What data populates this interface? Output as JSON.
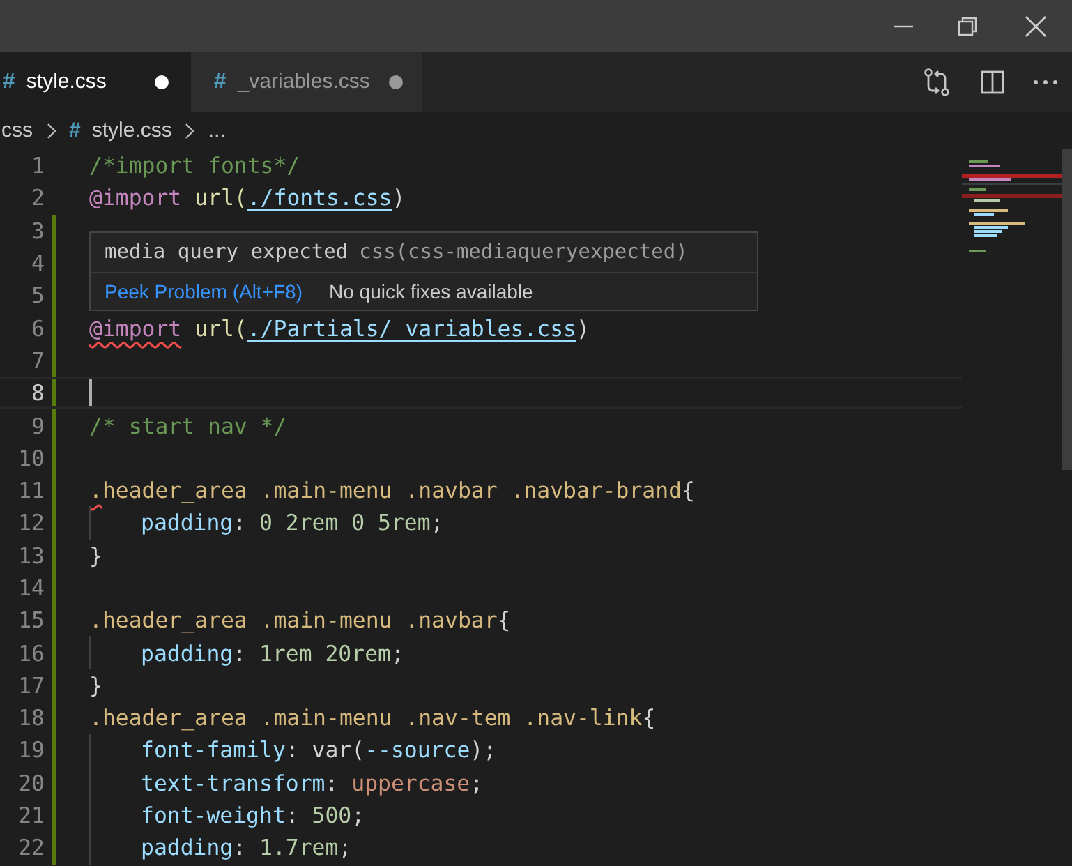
{
  "tabs": [
    {
      "icon": "#",
      "label": "style.css",
      "selected": true,
      "modified": true
    },
    {
      "icon": "#",
      "label": "_variables.css",
      "selected": false,
      "modified": true
    }
  ],
  "breadcrumb": [
    {
      "label": "css"
    },
    {
      "icon": "#",
      "label": "style.css"
    },
    {
      "label": "..."
    }
  ],
  "lines": [
    {
      "number": "1",
      "changed": false,
      "current": false,
      "tokens": [
        {
          "t": "/*import fonts*/",
          "kind": "comment"
        }
      ]
    },
    {
      "number": "2",
      "changed": false,
      "current": false,
      "tokens": [
        {
          "t": "@import",
          "kind": "atrule"
        },
        {
          "t": " url(",
          "kind": "func"
        },
        {
          "t": "./fonts.css",
          "kind": "link"
        },
        {
          "t": ")",
          "kind": "punct"
        }
      ]
    },
    {
      "number": "3",
      "changed": true,
      "current": false
    },
    {
      "number": "4",
      "changed": true,
      "current": false
    },
    {
      "number": "5",
      "changed": true,
      "current": false
    },
    {
      "number": "6",
      "changed": true,
      "current": false,
      "tokens": [
        {
          "t": "@import",
          "kind": "atrule",
          "squiggle": true
        },
        {
          "t": " url(",
          "kind": "func"
        },
        {
          "t": "./Partials/_variables.css",
          "kind": "link"
        },
        {
          "t": ")",
          "kind": "punct"
        }
      ]
    },
    {
      "number": "7",
      "changed": true,
      "current": false
    },
    {
      "number": "8",
      "changed": true,
      "current": true
    },
    {
      "number": "9",
      "changed": true,
      "current": false,
      "tokens": [
        {
          "t": "/* start nav */",
          "kind": "comment"
        }
      ]
    },
    {
      "number": "10",
      "changed": true,
      "current": false
    },
    {
      "number": "11",
      "changed": true,
      "current": false,
      "tokens": [
        {
          "t": ".",
          "kind": "selector",
          "squiggle": true
        },
        {
          "t": "header_area .main-menu .navbar .navbar-brand",
          "kind": "selector"
        },
        {
          "t": "{",
          "kind": "punct"
        }
      ]
    },
    {
      "number": "12",
      "changed": true,
      "current": false,
      "indented": true,
      "tokens": [
        {
          "t": "padding",
          "kind": "property"
        },
        {
          "t": ": ",
          "kind": "punct"
        },
        {
          "t": "0 2rem 0 5rem",
          "kind": "number"
        },
        {
          "t": ";",
          "kind": "punct"
        }
      ]
    },
    {
      "number": "13",
      "changed": true,
      "current": false,
      "tokens": [
        {
          "t": "}",
          "kind": "punct"
        }
      ]
    },
    {
      "number": "14",
      "changed": true,
      "current": false
    },
    {
      "number": "15",
      "changed": true,
      "current": false,
      "tokens": [
        {
          "t": ".header_area .main-menu .navbar",
          "kind": "selector"
        },
        {
          "t": "{",
          "kind": "punct"
        }
      ]
    },
    {
      "number": "16",
      "changed": true,
      "current": false,
      "indented": true,
      "tokens": [
        {
          "t": "padding",
          "kind": "property"
        },
        {
          "t": ": ",
          "kind": "punct"
        },
        {
          "t": "1rem 20rem",
          "kind": "number"
        },
        {
          "t": ";",
          "kind": "punct"
        }
      ]
    },
    {
      "number": "17",
      "changed": true,
      "current": false,
      "tokens": [
        {
          "t": "}",
          "kind": "punct"
        }
      ]
    },
    {
      "number": "18",
      "changed": true,
      "current": false,
      "tokens": [
        {
          "t": ".header_area .main-menu .nav-tem .nav-link",
          "kind": "selector"
        },
        {
          "t": "{",
          "kind": "punct"
        }
      ]
    },
    {
      "number": "19",
      "changed": true,
      "current": false,
      "indented": true,
      "tokens": [
        {
          "t": "font-family",
          "kind": "property"
        },
        {
          "t": ": ",
          "kind": "punct"
        },
        {
          "t": "var(",
          "kind": "punct"
        },
        {
          "t": "--source",
          "kind": "property"
        },
        {
          "t": ");",
          "kind": "punct"
        }
      ]
    },
    {
      "number": "20",
      "changed": true,
      "current": false,
      "indented": true,
      "tokens": [
        {
          "t": "text-transform",
          "kind": "property"
        },
        {
          "t": ": ",
          "kind": "punct"
        },
        {
          "t": "uppercase",
          "kind": "value"
        },
        {
          "t": ";",
          "kind": "punct"
        }
      ]
    },
    {
      "number": "21",
      "changed": true,
      "current": false,
      "indented": true,
      "tokens": [
        {
          "t": "font-weight",
          "kind": "property"
        },
        {
          "t": ": ",
          "kind": "punct"
        },
        {
          "t": "500",
          "kind": "number"
        },
        {
          "t": ";",
          "kind": "punct"
        }
      ]
    },
    {
      "number": "22",
      "changed": true,
      "current": false,
      "indented": true,
      "tokens": [
        {
          "t": "padding",
          "kind": "property"
        },
        {
          "t": ": ",
          "kind": "punct"
        },
        {
          "t": "1.7rem",
          "kind": "number"
        },
        {
          "t": ";",
          "kind": "punct"
        }
      ]
    }
  ],
  "hover": {
    "message": "media query expected",
    "source": "css(css-mediaqueryexpected)",
    "action": "Peek Problem (Alt+F8)",
    "note": "No quick fixes available"
  }
}
